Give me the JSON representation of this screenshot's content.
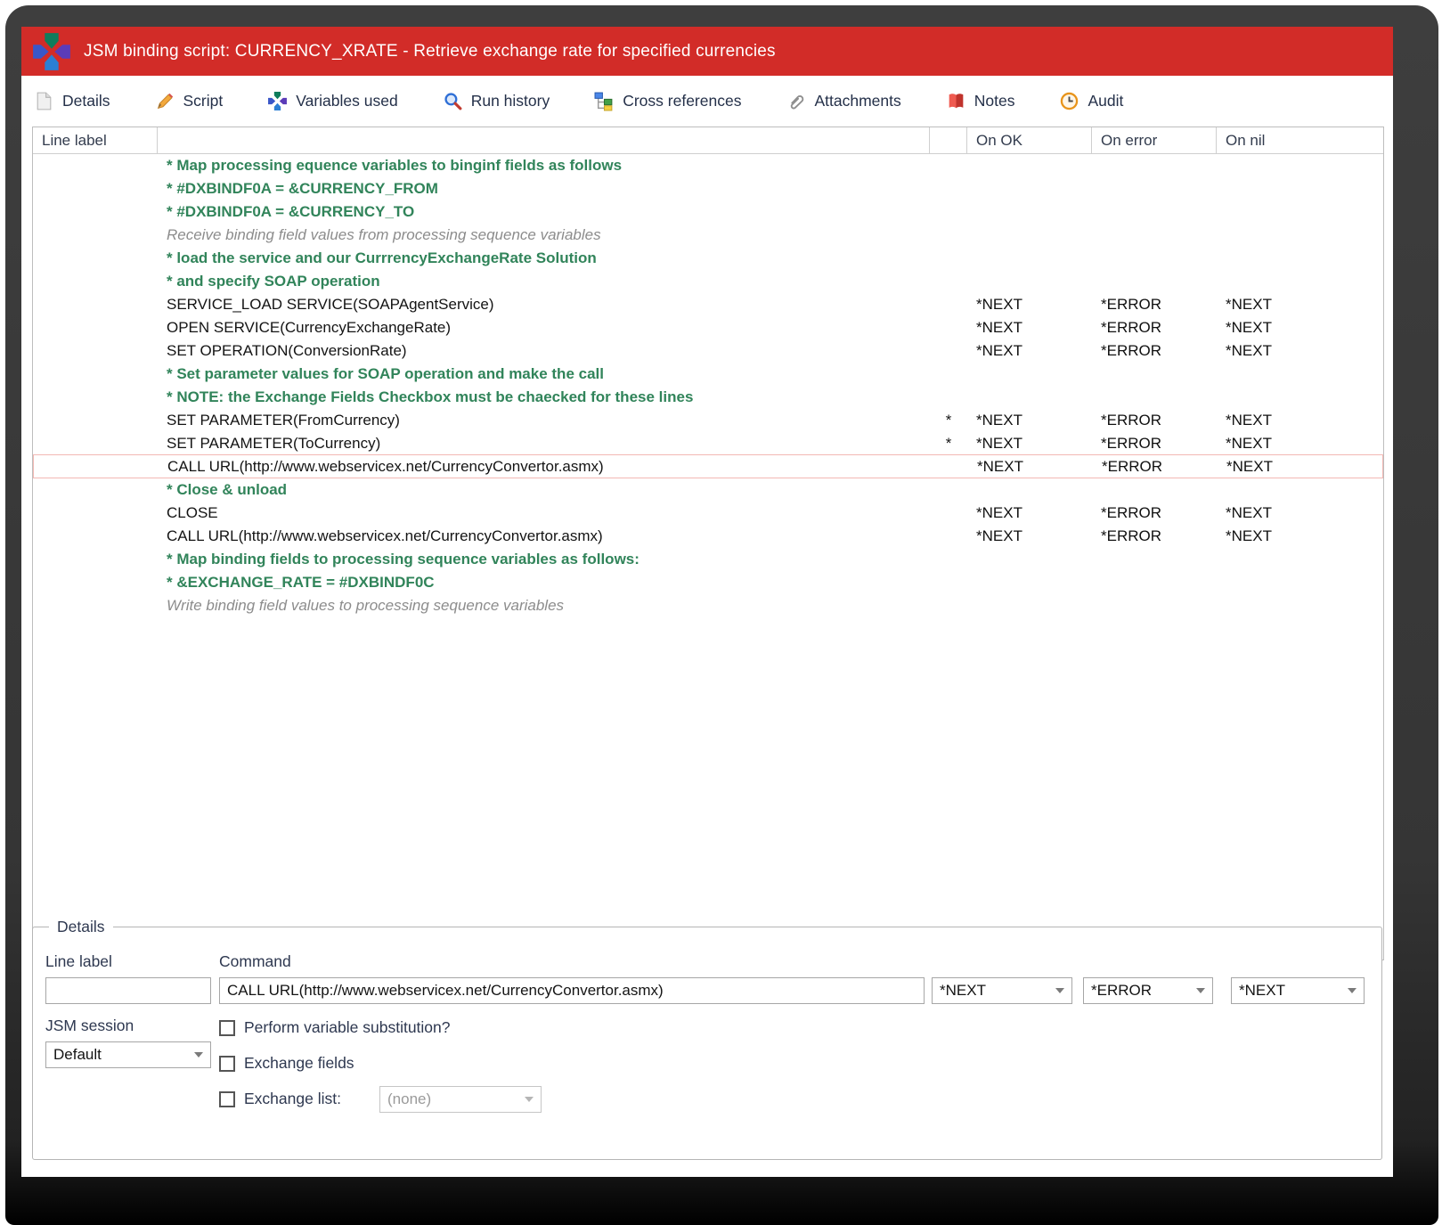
{
  "window": {
    "title": "JSM binding script: CURRENCY_XRATE - Retrieve exchange rate for specified currencies"
  },
  "toolbar": {
    "items": [
      {
        "label": "Details",
        "icon": "page-icon"
      },
      {
        "label": "Script",
        "icon": "pencil-icon"
      },
      {
        "label": "Variables used",
        "icon": "variables-cross-icon"
      },
      {
        "label": "Run history",
        "icon": "magnifier-icon"
      },
      {
        "label": "Cross references",
        "icon": "hierarchy-icon"
      },
      {
        "label": "Attachments",
        "icon": "paperclip-icon"
      },
      {
        "label": "Notes",
        "icon": "book-icon"
      },
      {
        "label": "Audit",
        "icon": "clock-icon"
      }
    ]
  },
  "grid": {
    "columns": [
      "Line label",
      "",
      "",
      "On OK",
      "On error",
      "On nil"
    ],
    "rows": [
      {
        "type": "comment",
        "text": "* Map processing equence variables to binginf fields as follows"
      },
      {
        "type": "comment",
        "text": "* #DXBINDF0A = &CURRENCY_FROM"
      },
      {
        "type": "comment",
        "text": "* #DXBINDF0A = &CURRENCY_TO"
      },
      {
        "type": "info",
        "text": "Receive binding field values from processing sequence variables"
      },
      {
        "type": "comment",
        "text": "* load the service and our CurrrencyExchangeRate Solution"
      },
      {
        "type": "comment",
        "text": "* and specify SOAP operation"
      },
      {
        "type": "command",
        "text": "SERVICE_LOAD SERVICE(SOAPAgentService)",
        "star": "",
        "on_ok": "*NEXT",
        "on_error": "*ERROR",
        "on_nil": "*NEXT"
      },
      {
        "type": "command",
        "text": "OPEN SERVICE(CurrencyExchangeRate)",
        "star": "",
        "on_ok": "*NEXT",
        "on_error": "*ERROR",
        "on_nil": "*NEXT"
      },
      {
        "type": "command",
        "text": "SET OPERATION(ConversionRate)",
        "star": "",
        "on_ok": "*NEXT",
        "on_error": "*ERROR",
        "on_nil": "*NEXT"
      },
      {
        "type": "comment",
        "text": "* Set parameter values for SOAP operation and make the call"
      },
      {
        "type": "comment",
        "text": "* NOTE: the Exchange Fields Checkbox must be chaecked for these lines"
      },
      {
        "type": "command",
        "text": "SET PARAMETER(FromCurrency)",
        "star": "*",
        "on_ok": "*NEXT",
        "on_error": "*ERROR",
        "on_nil": "*NEXT"
      },
      {
        "type": "command",
        "text": "SET PARAMETER(ToCurrency)",
        "star": "*",
        "on_ok": "*NEXT",
        "on_error": "*ERROR",
        "on_nil": "*NEXT"
      },
      {
        "type": "command",
        "text": "CALL URL(http://www.webservicex.net/CurrencyConvertor.asmx)",
        "star": "",
        "on_ok": "*NEXT",
        "on_error": "*ERROR",
        "on_nil": "*NEXT",
        "selected": true
      },
      {
        "type": "comment",
        "text": "* Close & unload"
      },
      {
        "type": "command",
        "text": "CLOSE",
        "star": "",
        "on_ok": "*NEXT",
        "on_error": "*ERROR",
        "on_nil": "*NEXT"
      },
      {
        "type": "command",
        "text": "CALL URL(http://www.webservicex.net/CurrencyConvertor.asmx)",
        "star": "",
        "on_ok": "*NEXT",
        "on_error": "*ERROR",
        "on_nil": "*NEXT"
      },
      {
        "type": "comment",
        "text": "* Map binding fields to processing sequence variables as follows:"
      },
      {
        "type": "comment",
        "text": "* &EXCHANGE_RATE = #DXBINDF0C"
      },
      {
        "type": "info",
        "text": "Write binding field values to processing sequence variables"
      }
    ]
  },
  "details": {
    "legend": "Details",
    "line_label": {
      "label": "Line label",
      "value": ""
    },
    "command": {
      "label": "Command",
      "value": "CALL URL(http://www.webservicex.net/CurrencyConvertor.asmx)"
    },
    "on_ok": "*NEXT",
    "on_error": "*ERROR",
    "on_nil": "*NEXT",
    "jsm_session": {
      "label": "JSM session",
      "value": "Default"
    },
    "checkboxes": [
      {
        "label": "Perform variable substitution?",
        "checked": false
      },
      {
        "label": "Exchange fields",
        "checked": false
      },
      {
        "label": "Exchange list:",
        "checked": false
      }
    ],
    "exchange_list_value": "(none)"
  },
  "colors": {
    "titlebar_red": "#d22c28",
    "comment_green": "#31845a",
    "info_gray": "#8c8c8c",
    "selected_border": "#f3b8b4",
    "toolbar_text": "#243049"
  }
}
